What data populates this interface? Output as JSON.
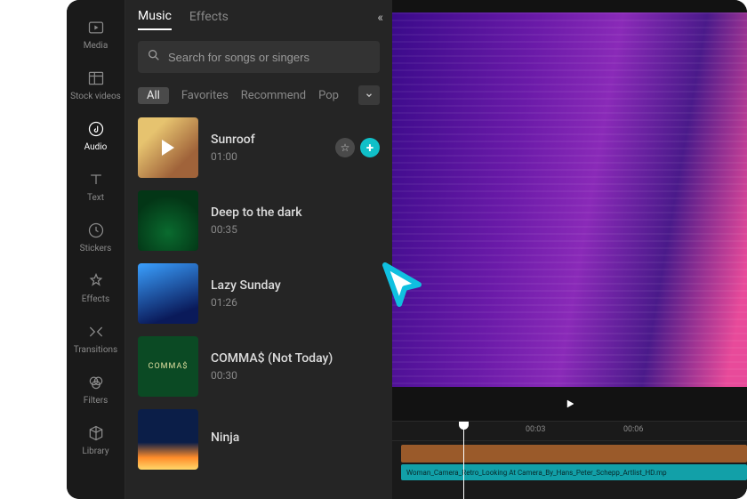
{
  "nav": {
    "items": [
      {
        "label": "Media",
        "icon": "media"
      },
      {
        "label": "Stock videos",
        "icon": "stock"
      },
      {
        "label": "Audio",
        "icon": "audio"
      },
      {
        "label": "Text",
        "icon": "text"
      },
      {
        "label": "Stickers",
        "icon": "stickers"
      },
      {
        "label": "Effects",
        "icon": "effects"
      },
      {
        "label": "Transitions",
        "icon": "transitions"
      },
      {
        "label": "Filters",
        "icon": "filters"
      },
      {
        "label": "Library",
        "icon": "library"
      }
    ],
    "active_index": 2
  },
  "panel": {
    "tabs": [
      "Music",
      "Effects"
    ],
    "active_tab": 0,
    "search_placeholder": "Search for songs or singers",
    "categories": [
      "All",
      "Favorites",
      "Recommend",
      "Pop"
    ],
    "active_category": 0,
    "tracks": [
      {
        "name": "Sunroof",
        "duration": "01:00",
        "thumb": "orange",
        "playing": true,
        "actions": true
      },
      {
        "name": "Deep to the dark",
        "duration": "00:35",
        "thumb": "green"
      },
      {
        "name": "Lazy Sunday",
        "duration": "01:26",
        "thumb": "blue"
      },
      {
        "name": "COMMA$ (Not Today)",
        "duration": "00:30",
        "thumb": "deepg",
        "thumb_text": "COMMA$"
      },
      {
        "name": "Ninja",
        "duration": "",
        "thumb": "sunset"
      }
    ]
  },
  "timeline": {
    "ticks": [
      {
        "label": "00:03",
        "pos": 150
      },
      {
        "label": "00:06",
        "pos": 260
      }
    ],
    "audio_clip_label": "Woman_Camera_Retro_Looking At Camera_By_Hans_Peter_Schepp_Artlist_HD.mp"
  }
}
